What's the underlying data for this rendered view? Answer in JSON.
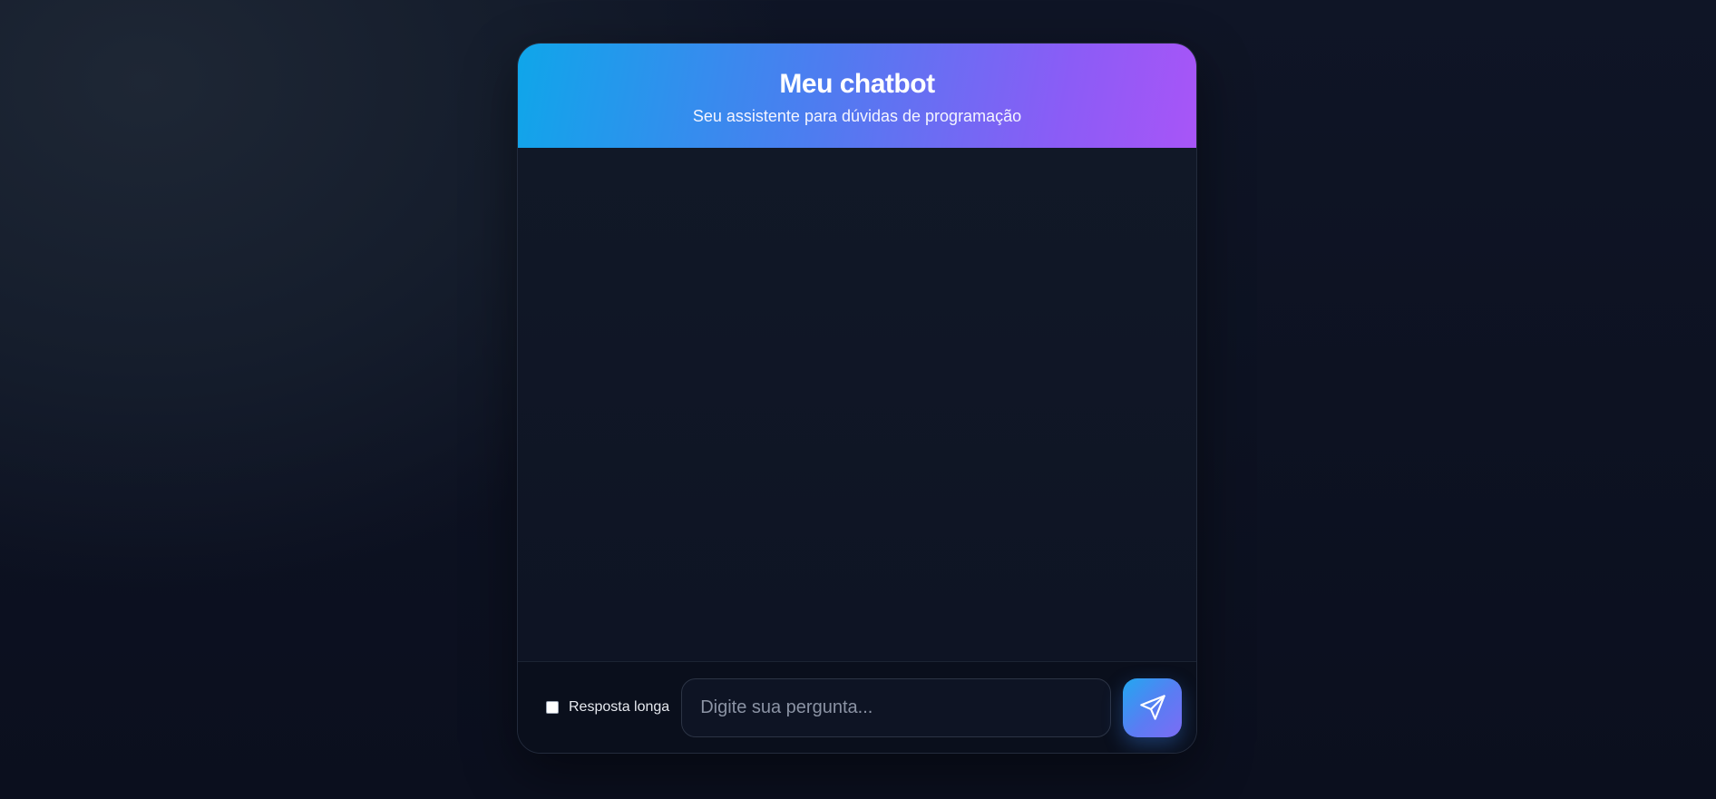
{
  "header": {
    "title": "Meu chatbot",
    "subtitle": "Seu assistente para dúvidas de programação"
  },
  "footer": {
    "long_answer_label": "Resposta longa",
    "long_answer_checked": false,
    "input_placeholder": "Digite sua pergunta...",
    "input_value": "",
    "send_icon": "send-icon"
  },
  "colors": {
    "header_gradient_start": "#0fa6ea",
    "header_gradient_end": "#a855f7",
    "background": "#0b0f1e",
    "card": "#0f1625"
  }
}
